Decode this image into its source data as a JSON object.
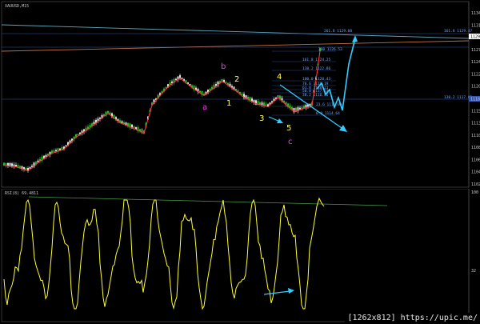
{
  "price_panel": {
    "symbol_line": "XAUUSD,M15",
    "y_axis_labels": [
      "1134",
      "1131",
      "1129",
      "1127",
      "1124",
      "1122",
      "1120",
      "1117",
      "1115",
      "1113",
      "1110",
      "1108",
      "1106",
      "1104",
      "1102"
    ],
    "level_labels": {
      "upper_left": "261.8  1129.08",
      "upper_right": "161.8  1129.47",
      "l200": "200  1126.53",
      "l161": "161.8  1124.25",
      "l138": "138.2  1122.86",
      "l100": "100.0  1120.43",
      "l78": "78.6  1119.19",
      "l61": "61.8  1118.21",
      "l50": "50.0  1117.53",
      "l38": "38.2  1116.86",
      "l23": "23.6  1116.00",
      "l0": "0.0  1114.64",
      "l138b": "138.2  1117.65"
    },
    "price_tags": {
      "top": "1129",
      "mid": "1118"
    },
    "wave_labels": [
      {
        "text": "b",
        "color": "#ff33ff"
      },
      {
        "text": "a",
        "color": "#ff33ff"
      },
      {
        "text": "c",
        "color": "#ff33ff"
      },
      {
        "text": "1",
        "color": "#ffff66"
      },
      {
        "text": "2",
        "color": "#ffff66"
      },
      {
        "text": "3",
        "color": "#ffff66"
      },
      {
        "text": "4",
        "color": "#ffff66"
      },
      {
        "text": "5",
        "color": "#ffff66"
      }
    ]
  },
  "rsi_panel": {
    "title": "RSI(8) 69.4811",
    "y_axis_labels": [
      "100",
      "32",
      "0"
    ]
  },
  "watermark": "[1262x812] https://upic.me/",
  "colors": {
    "background": "#000000",
    "bull_candle": "#33cc33",
    "bear_candle": "#ffffff",
    "moving_average": "#ff3333",
    "rsi_line": "#ffff33",
    "trend_arrow": "#33ccff",
    "wave_impulse": "#ffff66",
    "wave_correction": "#ff33ff"
  }
}
